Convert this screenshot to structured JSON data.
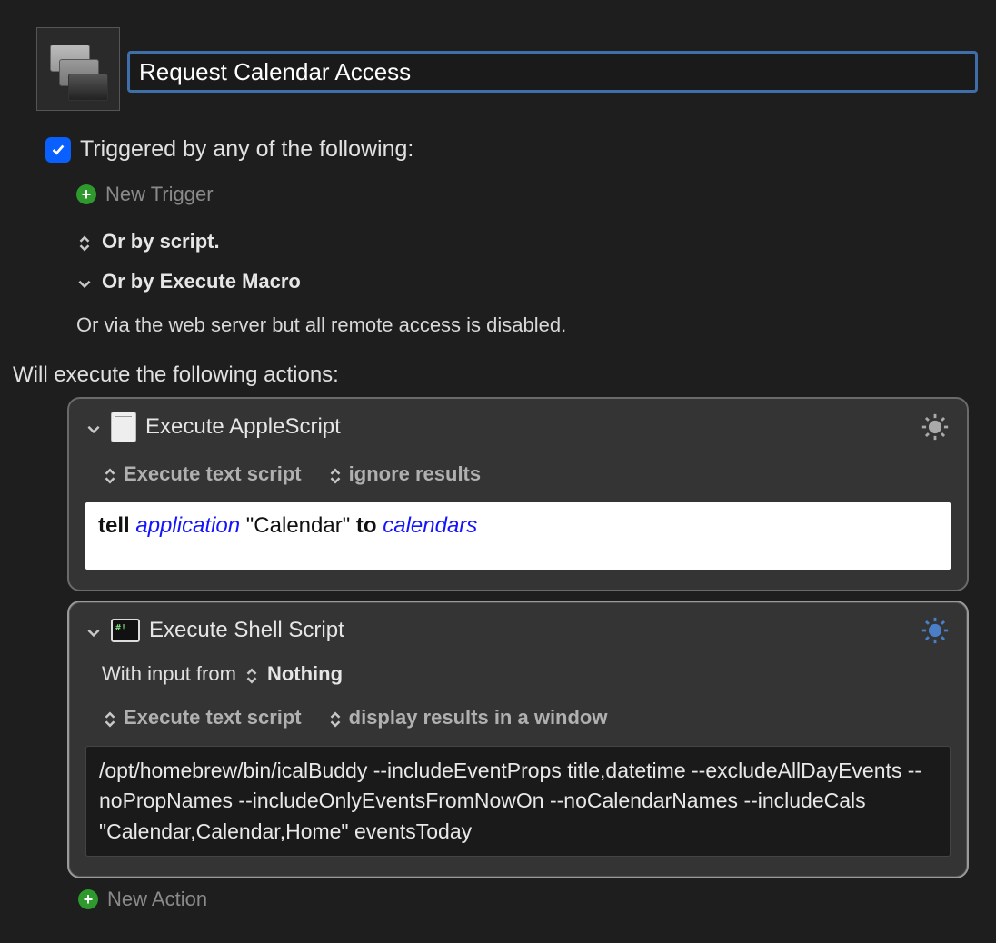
{
  "macro": {
    "title": "Request Calendar Access"
  },
  "triggers": {
    "checkbox_label": "Triggered by any of the following:",
    "new_trigger": "New Trigger",
    "by_script": "Or by script.",
    "by_execute_macro": "Or by Execute Macro",
    "web_server_note": "Or via the web server but all remote access is disabled."
  },
  "actions_header": "Will execute the following actions:",
  "action1": {
    "title": "Execute AppleScript",
    "opt_execute": "Execute text script",
    "opt_result": "ignore results",
    "script_tell": "tell",
    "script_application": "application",
    "script_quoted": "\"Calendar\"",
    "script_to": "to",
    "script_calendars": "calendars"
  },
  "action2": {
    "title": "Execute Shell Script",
    "input_label": "With input from",
    "input_value": "Nothing",
    "opt_execute": "Execute text script",
    "opt_result": "display results in a window",
    "shell": "/opt/homebrew/bin/icalBuddy --includeEventProps title,datetime --excludeAllDayEvents --noPropNames --includeOnlyEventsFromNowOn --noCalendarNames --includeCals \"Calendar,Calendar,Home\" eventsToday"
  },
  "footer": {
    "new_action": "New Action"
  }
}
